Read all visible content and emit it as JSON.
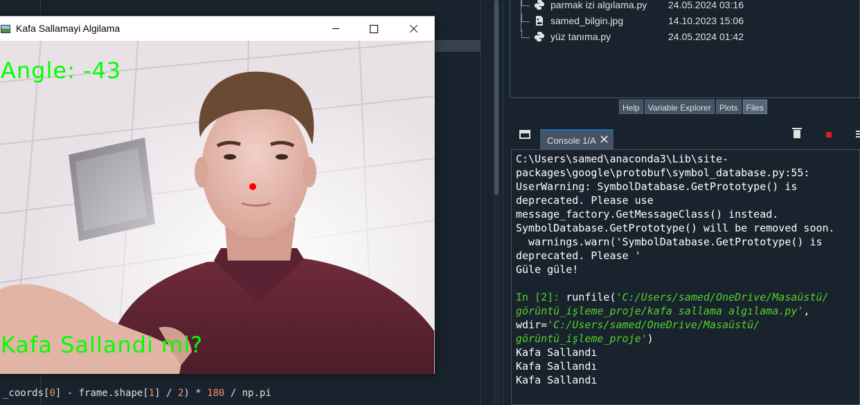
{
  "editor": {
    "code_line_prefix": "_coords[",
    "code_line_idx0": "0",
    "code_line_mid": "] - frame.shape[",
    "code_line_idx1": "1",
    "code_line_mid2": "] / ",
    "code_line_two": "2",
    "code_line_mid3": ") * ",
    "code_line_deg": "180",
    "code_line_end": " / np.pi"
  },
  "files": {
    "rows": [
      {
        "name": "parmak izi algılama.py",
        "date": "24.05.2024 03:16",
        "icon": "python-file-icon"
      },
      {
        "name": "samed_bilgin.jpg",
        "date": "14.10.2023 15:06",
        "icon": "image-file-icon"
      },
      {
        "name": "yüz tanıma.py",
        "date": "24.05.2024 01:42",
        "icon": "python-file-icon"
      }
    ]
  },
  "pane_tabs": [
    "Help",
    "Variable Explorer",
    "Plots",
    "Files"
  ],
  "pane_tabs_active": "Files",
  "console": {
    "tab_label": "Console 1/A",
    "lines": {
      "l1": "C:\\Users\\samed\\anaconda3\\Lib\\site-",
      "l2": "packages\\google\\protobuf\\symbol_database.py:55:",
      "l3": "UserWarning: SymbolDatabase.GetPrototype() is",
      "l4": "deprecated. Please use",
      "l5": "message_factory.GetMessageClass() instead.",
      "l6": "SymbolDatabase.GetPrototype() will be removed soon.",
      "l7": "  warnings.warn('SymbolDatabase.GetPrototype() is",
      "l8": "deprecated. Please '",
      "l9": "Güle güle!",
      "prompt": "In [2]: ",
      "cmd_a": "runfile(",
      "str_a": "'C:/Users/samed/OneDrive/Masaüstü/",
      "str_b": "görüntü_işleme_proje/kafa sallama algılama.py'",
      "cmd_b": ",",
      "cmd_c": "wdir=",
      "str_c": "'C:/Users/samed/OneDrive/Masaüstü/",
      "str_d": "görüntü_işleme_proje'",
      "cmd_d": ")",
      "out1": "Kafa Sallandı",
      "out2": "Kafa Sallandı",
      "out3": "Kafa Sallandı"
    }
  },
  "cv_window": {
    "title": "Kafa Sallamayi Algilama",
    "angle_text": "Angle: -43",
    "status_text": "Kafa Sallandi mi?",
    "overlay_color": "#00ff00",
    "landmark_color": "#ff0000"
  },
  "colors": {
    "ide_background": "#19232d",
    "accent": "#1a72bb",
    "prompt_green": "#54d22c"
  }
}
